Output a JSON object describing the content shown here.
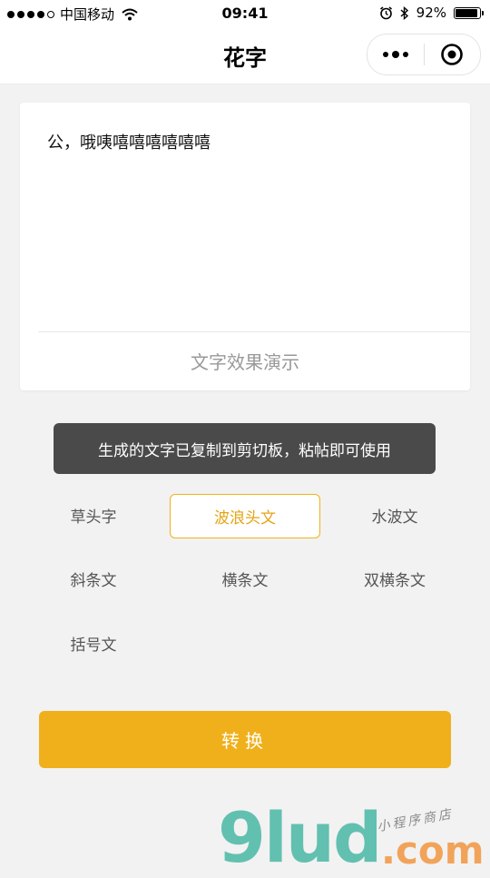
{
  "status_bar": {
    "carrier": "中国移动",
    "time": "09:41",
    "battery_percent": "92%",
    "battery_level": 0.92
  },
  "nav": {
    "title": "花字"
  },
  "card": {
    "input_text": "公，哦咦嘻嘻嘻嘻嘻嘻",
    "demo_text": "文字效果演示"
  },
  "toast": {
    "message": "生成的文字已复制到剪切板，粘帖即可使用"
  },
  "options": [
    {
      "label": "草头字"
    },
    {
      "label": "波浪头文",
      "selected": true
    },
    {
      "label": "水波文"
    },
    {
      "label": "斜条文"
    },
    {
      "label": "横条文"
    },
    {
      "label": "双横条文"
    },
    {
      "label": "括号文"
    }
  ],
  "convert_button": {
    "label": "转换"
  },
  "watermark": {
    "logo": "9lud",
    "domain": ".com",
    "tagline": "小程序商店"
  },
  "colors": {
    "accent": "#f0b01b",
    "toast_bg": "#3c3c3c",
    "page_bg": "#f2f2f2"
  }
}
